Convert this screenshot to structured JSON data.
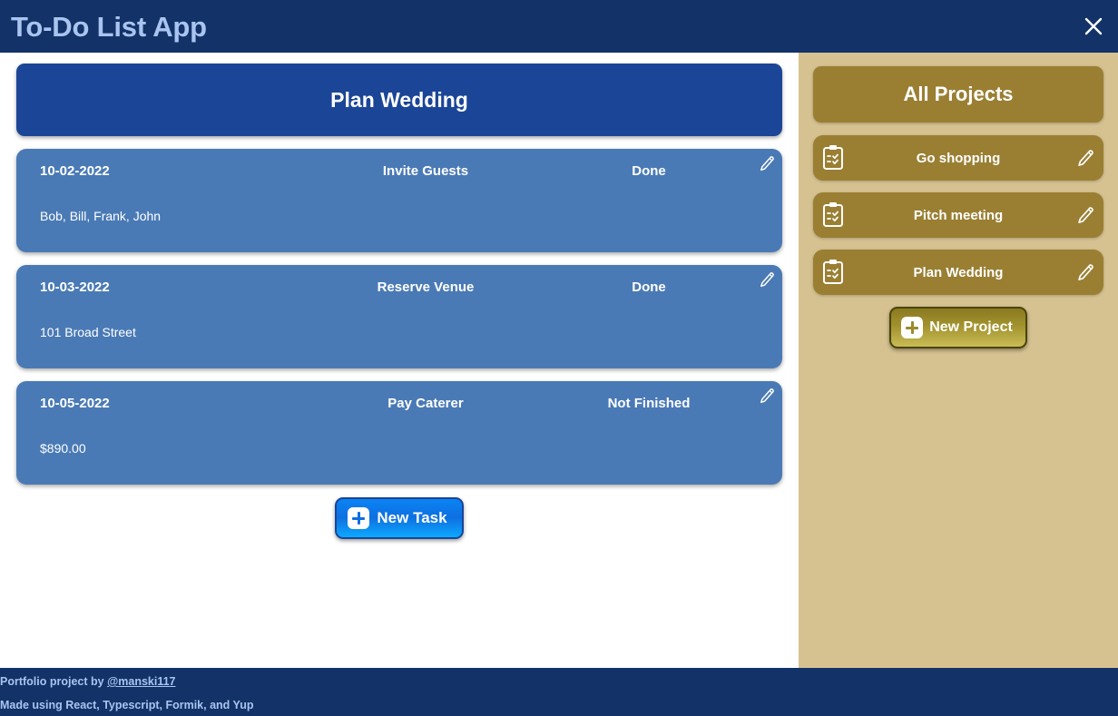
{
  "header": {
    "title": "To-Do List App",
    "close_icon": "close-icon"
  },
  "main": {
    "project_banner": "Plan Wedding",
    "tasks": [
      {
        "date": "10-02-2022",
        "name": "Invite Guests",
        "status": "Done",
        "detail": "Bob, Bill, Frank, John",
        "edit_icon": "pencil-icon"
      },
      {
        "date": "10-03-2022",
        "name": "Reserve Venue",
        "status": "Done",
        "detail": "101 Broad Street",
        "edit_icon": "pencil-icon"
      },
      {
        "date": "10-05-2022",
        "name": "Pay Caterer",
        "status": "Not Finished",
        "detail": "$890.00",
        "edit_icon": "pencil-icon"
      }
    ],
    "new_task_label": "New Task",
    "new_task_icon": "plus-icon"
  },
  "sidebar": {
    "all_projects_label": "All Projects",
    "projects": [
      {
        "label": "Go shopping",
        "icon": "clipboard-checklist-icon",
        "edit_icon": "pencil-icon"
      },
      {
        "label": "Pitch meeting",
        "icon": "clipboard-checklist-icon",
        "edit_icon": "pencil-icon"
      },
      {
        "label": "Plan Wedding",
        "icon": "clipboard-checklist-icon",
        "edit_icon": "pencil-icon"
      }
    ],
    "new_project_label": "New Project",
    "new_project_icon": "plus-icon"
  },
  "footer": {
    "line1_prefix": "Portfolio project by ",
    "line1_link": "@manski117",
    "line2": "Made using React, Typescript, Formik, and Yup"
  },
  "colors": {
    "header_navy": "#123268",
    "banner_blue": "#1b4596",
    "task_blue": "#4a7ab5",
    "sidebar_tan": "#d6c291",
    "project_gold": "#9a7f33",
    "title_text": "#a9c4ef"
  }
}
